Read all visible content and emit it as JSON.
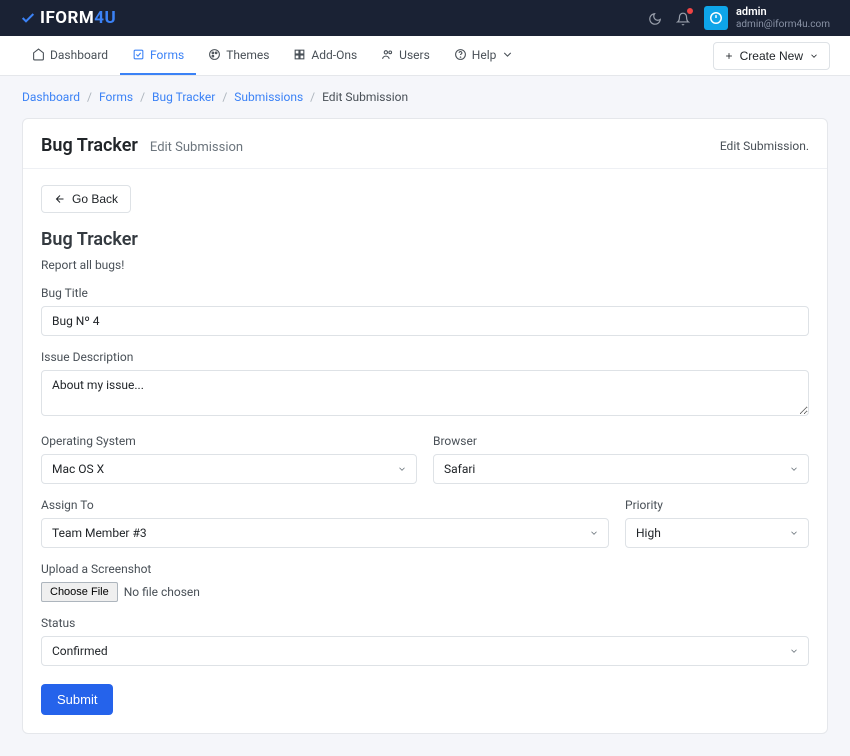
{
  "brand": {
    "name": "IFORM",
    "suffix": "4U"
  },
  "topbar": {
    "user_name": "admin",
    "user_email": "admin@iform4u.com"
  },
  "nav": {
    "items": [
      {
        "label": "Dashboard"
      },
      {
        "label": "Forms"
      },
      {
        "label": "Themes"
      },
      {
        "label": "Add-Ons"
      },
      {
        "label": "Users"
      },
      {
        "label": "Help"
      }
    ],
    "create_label": "Create New"
  },
  "breadcrumbs": {
    "items": [
      "Dashboard",
      "Forms",
      "Bug Tracker",
      "Submissions"
    ],
    "current": "Edit Submission"
  },
  "card": {
    "title": "Bug Tracker",
    "subtitle": "Edit Submission",
    "action_text": "Edit Submission."
  },
  "form": {
    "go_back": "Go Back",
    "heading": "Bug Tracker",
    "description": "Report all bugs!",
    "fields": {
      "bug_title": {
        "label": "Bug Title",
        "value": "Bug Nº 4"
      },
      "issue_desc": {
        "label": "Issue Description",
        "value": "About my issue..."
      },
      "os": {
        "label": "Operating System",
        "value": "Mac OS X"
      },
      "browser": {
        "label": "Browser",
        "value": "Safari"
      },
      "assign_to": {
        "label": "Assign To",
        "value": "Team Member #3"
      },
      "priority": {
        "label": "Priority",
        "value": "High"
      },
      "screenshot": {
        "label": "Upload a Screenshot",
        "button": "Choose File",
        "no_file": "No file chosen"
      },
      "status": {
        "label": "Status",
        "value": "Confirmed"
      }
    },
    "submit_label": "Submit"
  }
}
